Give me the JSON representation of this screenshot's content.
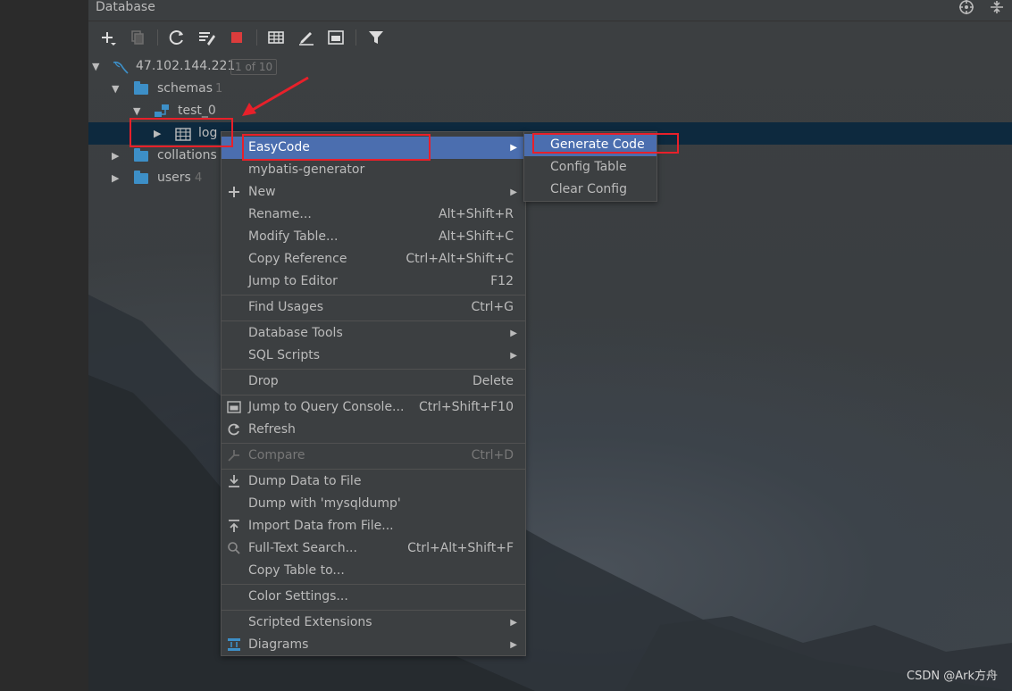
{
  "panel": {
    "title": "Database"
  },
  "toolbar": {
    "icons": [
      "plus-icon",
      "copy-icon",
      "refresh-icon",
      "schema-sync-icon",
      "stop-icon",
      "table-icon",
      "edit-icon",
      "query-console-icon",
      "filter-icon"
    ]
  },
  "tree": {
    "connection": {
      "label": "47.102.144.221",
      "badge": "1 of 10"
    },
    "schemas": {
      "label": "schemas",
      "count": "1"
    },
    "schema_item": {
      "label": "test_0"
    },
    "table_item": {
      "label": "log"
    },
    "collations": {
      "label": "collations"
    },
    "users": {
      "label": "users",
      "count": "4"
    }
  },
  "context_menu": {
    "items": [
      {
        "label": "EasyCode",
        "submenu": true
      },
      {
        "label": "mybatis-generator"
      },
      {
        "label": "New",
        "submenu": true
      },
      {
        "label": "Rename...",
        "shortcut": "Alt+Shift+R"
      },
      {
        "label": "Modify Table...",
        "shortcut": "Alt+Shift+C"
      },
      {
        "label": "Copy Reference",
        "shortcut": "Ctrl+Alt+Shift+C"
      },
      {
        "label": "Jump to Editor",
        "shortcut": "F12"
      },
      {
        "label": "Find Usages",
        "shortcut": "Ctrl+G"
      },
      {
        "label": "Database Tools",
        "submenu": true
      },
      {
        "label": "SQL Scripts",
        "submenu": true
      },
      {
        "label": "Drop",
        "shortcut": "Delete"
      },
      {
        "label": "Jump to Query Console...",
        "shortcut": "Ctrl+Shift+F10"
      },
      {
        "label": "Refresh"
      },
      {
        "label": "Compare",
        "shortcut": "Ctrl+D"
      },
      {
        "label": "Dump Data to File"
      },
      {
        "label": "Dump with 'mysqldump'"
      },
      {
        "label": "Import Data from File..."
      },
      {
        "label": "Full-Text Search...",
        "shortcut": "Ctrl+Alt+Shift+F"
      },
      {
        "label": "Copy Table to..."
      },
      {
        "label": "Color Settings..."
      },
      {
        "label": "Scripted Extensions",
        "submenu": true
      },
      {
        "label": "Diagrams",
        "submenu": true
      }
    ]
  },
  "submenu": {
    "items": [
      {
        "label": "Generate Code"
      },
      {
        "label": "Config Table"
      },
      {
        "label": "Clear Config"
      }
    ]
  },
  "watermark": "CSDN @Ark方舟",
  "colors": {
    "highlight": "#4b6eaf",
    "annotation": "#e8202a",
    "folder": "#3d8fc7",
    "selection": "#0d293e"
  }
}
